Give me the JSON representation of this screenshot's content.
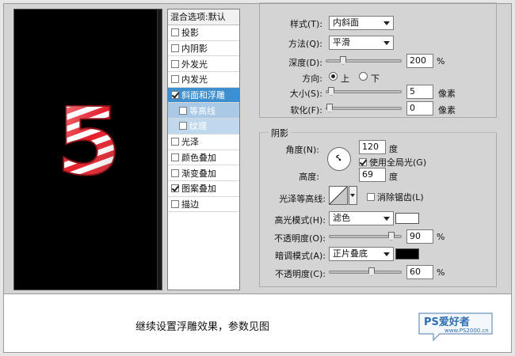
{
  "styles_panel": {
    "header": "混合选项:默认",
    "items": [
      {
        "label": "投影",
        "checked": false,
        "state": "normal"
      },
      {
        "label": "内阴影",
        "checked": false,
        "state": "normal"
      },
      {
        "label": "外发光",
        "checked": false,
        "state": "normal"
      },
      {
        "label": "内发光",
        "checked": false,
        "state": "normal"
      },
      {
        "label": "斜面和浮雕",
        "checked": true,
        "state": "active"
      },
      {
        "label": "等高线",
        "checked": false,
        "state": "sub"
      },
      {
        "label": "纹理",
        "checked": false,
        "state": "sub-light"
      },
      {
        "label": "光泽",
        "checked": false,
        "state": "normal"
      },
      {
        "label": "颜色叠加",
        "checked": false,
        "state": "normal"
      },
      {
        "label": "渐变叠加",
        "checked": false,
        "state": "normal"
      },
      {
        "label": "图案叠加",
        "checked": true,
        "state": "normal"
      },
      {
        "label": "描边",
        "checked": false,
        "state": "normal"
      }
    ]
  },
  "preview": {
    "glyph": "5",
    "background": "#000000",
    "stripe_colors": [
      "#e41e2a",
      "#ffffff"
    ]
  },
  "structure": {
    "style_label": "样式(T):",
    "style_value": "内斜面",
    "technique_label": "方法(Q):",
    "technique_value": "平滑",
    "depth_label": "深度(D):",
    "depth_value": "200",
    "depth_unit": "%",
    "depth_slider_fraction": 0.2,
    "direction_label": "方向:",
    "direction_up": "上",
    "direction_down": "下",
    "direction_selected": "上",
    "size_label": "大小(S):",
    "size_value": "5",
    "size_unit": "像素",
    "size_slider_fraction": 0.02,
    "soften_label": "软化(F):",
    "soften_value": "0",
    "soften_unit": "像素",
    "soften_slider_fraction": 0.0
  },
  "shading": {
    "section_title": "阴影",
    "angle_label": "角度(N):",
    "angle_value": "120",
    "angle_unit": "度",
    "global_light_label": "使用全局光(G)",
    "global_light_checked": true,
    "altitude_label": "高度:",
    "altitude_value": "69",
    "altitude_unit": "度",
    "gloss_contour_label": "光泽等高线:",
    "anti_alias_label": "消除锯齿(L)",
    "anti_alias_checked": false,
    "highlight_mode_label": "高光模式(H):",
    "highlight_mode_value": "滤色",
    "highlight_color": "#ffffff",
    "highlight_opacity_label": "不透明度(O):",
    "highlight_opacity_value": "90",
    "highlight_opacity_unit": "%",
    "highlight_opacity_fraction": 0.9,
    "shadow_mode_label": "暗调模式(A):",
    "shadow_mode_value": "正片叠底",
    "shadow_color": "#000000",
    "shadow_opacity_label": "不透明度(C):",
    "shadow_opacity_value": "60",
    "shadow_opacity_unit": "%",
    "shadow_opacity_fraction": 0.6
  },
  "caption": {
    "text": "继续设置浮雕效果，参数见图"
  },
  "logo": {
    "brand": "PS爱好者",
    "url": "www.PS2000.cn"
  }
}
